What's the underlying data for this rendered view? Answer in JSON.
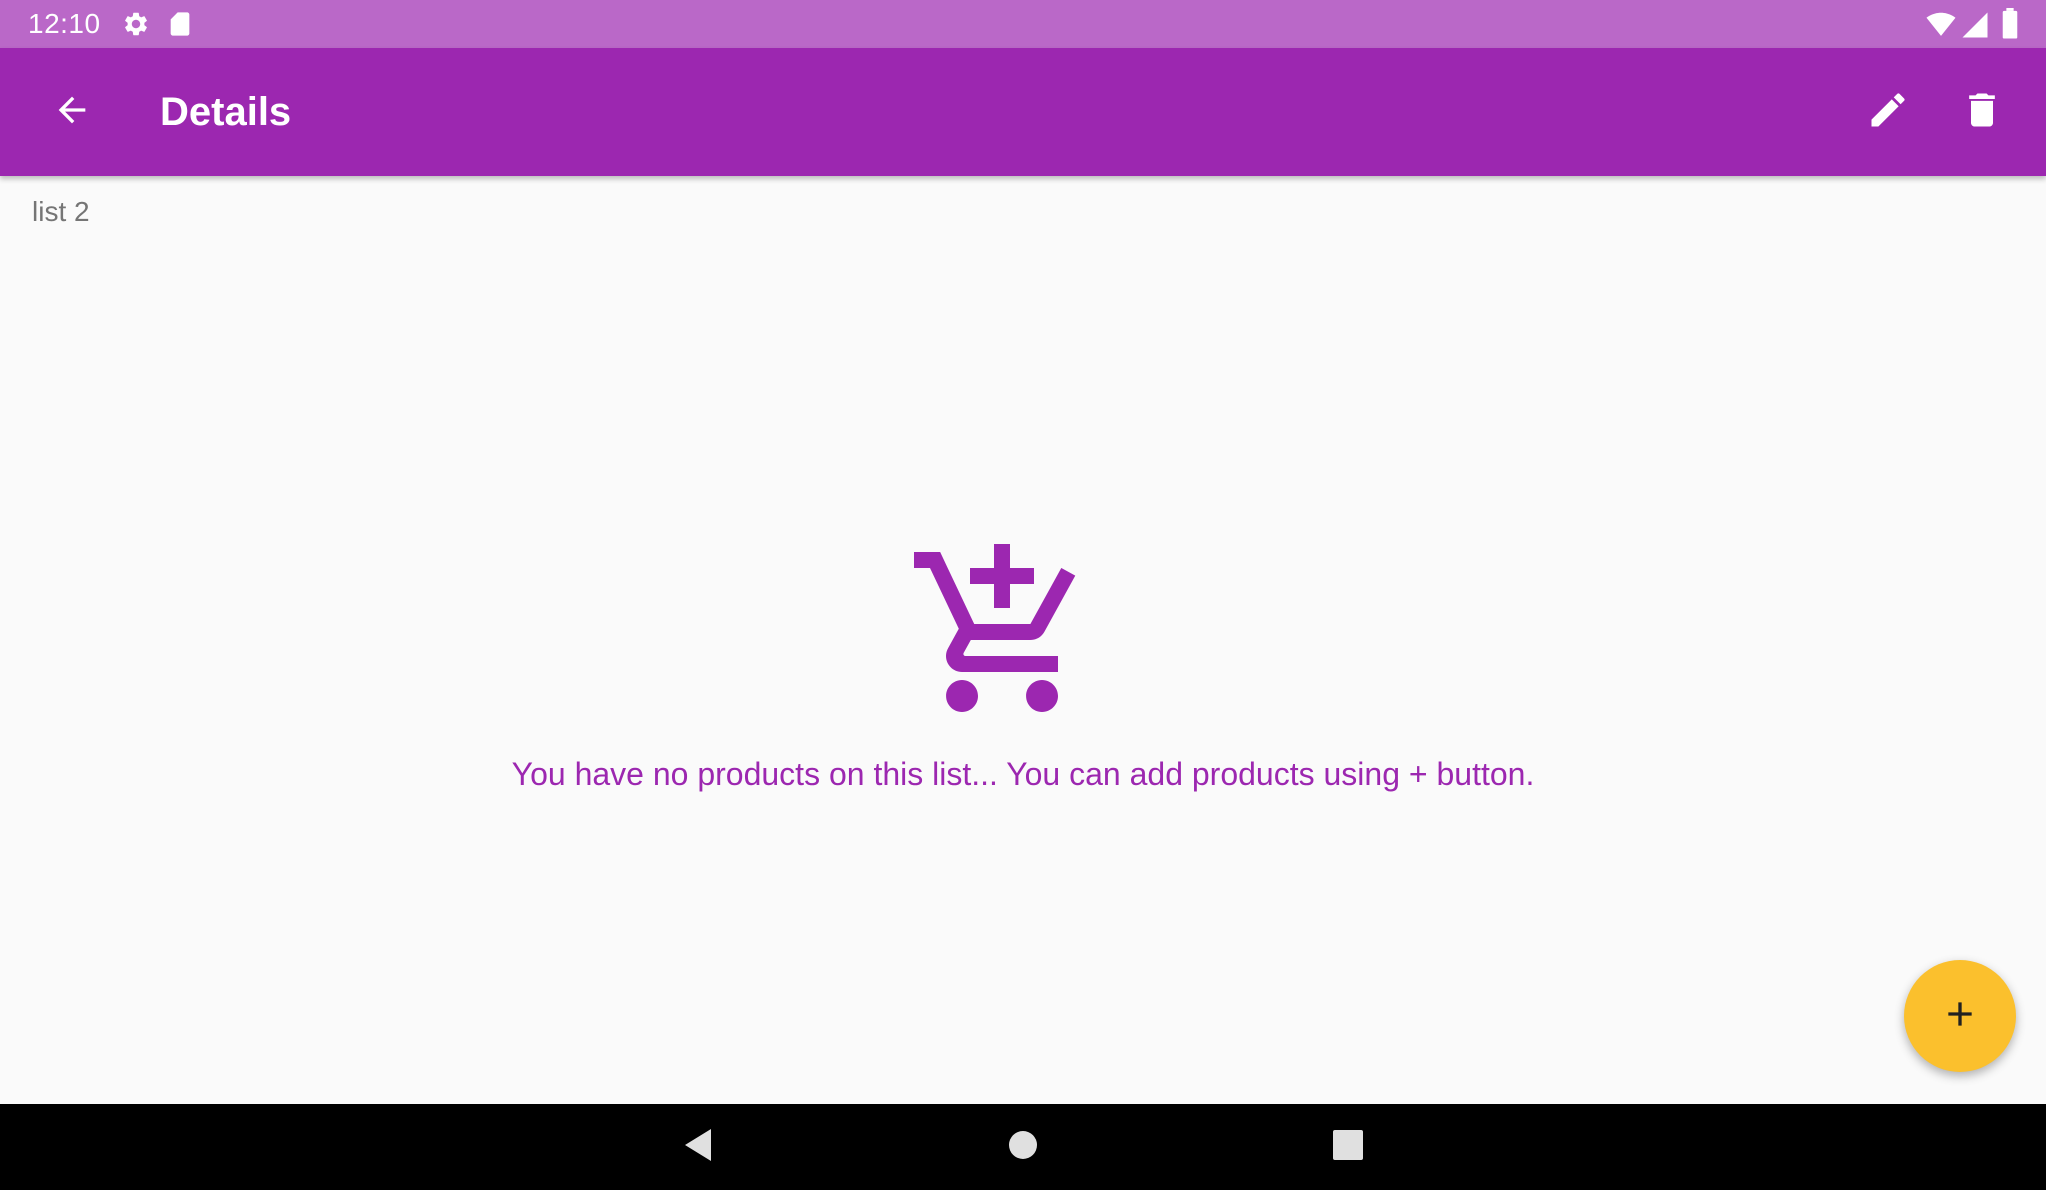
{
  "status_bar": {
    "time": "12:10",
    "icons": [
      "gear-icon",
      "sd-card-icon",
      "wifi-icon",
      "cellular-signal-icon",
      "battery-icon"
    ]
  },
  "app_bar": {
    "title": "Details",
    "back_icon": "arrow-back-icon",
    "edit_icon": "pencil-icon",
    "delete_icon": "trash-icon"
  },
  "content": {
    "list_name": "list 2",
    "empty_icon": "add-shopping-cart-icon",
    "empty_message": "You have no products on this list... You can add products using + button."
  },
  "fab": {
    "icon": "plus-icon"
  },
  "nav_bar": {
    "icons": [
      "nav-back-icon",
      "nav-home-icon",
      "nav-recents-icon"
    ]
  },
  "colors": {
    "status_bar": "#ba68c8",
    "app_bar": "#9c27b0",
    "accent": "#9c27b0",
    "fab": "#fbc02d",
    "background": "#fafafa",
    "nav_bar": "#000000"
  }
}
